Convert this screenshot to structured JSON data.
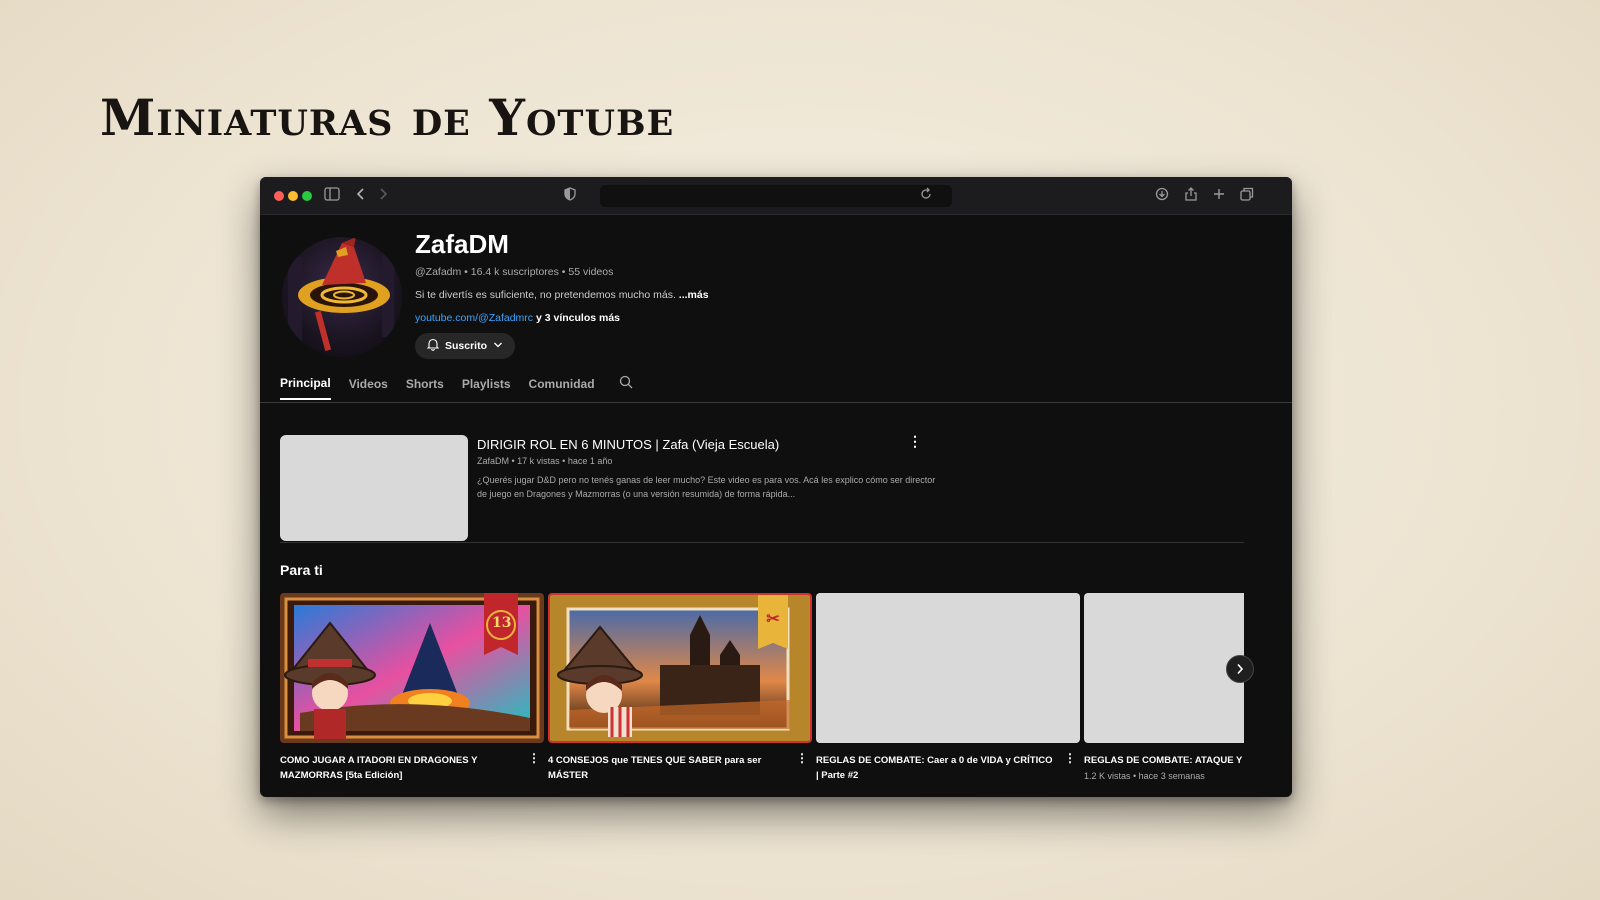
{
  "page_title": "Miniaturas de Yotube",
  "channel": {
    "name": "ZafaDM",
    "meta": "@Zafadm • 16.4 k suscriptores • 55 videos",
    "description": "Si te divertís es suficiente, no pretendemos mucho más.",
    "description_more": "...más",
    "link": "youtube.com/@Zafadmrc",
    "link_more": " y 3 vínculos más",
    "subscribe_label": "Suscrito"
  },
  "tabs": [
    "Principal",
    "Videos",
    "Shorts",
    "Playlists",
    "Comunidad"
  ],
  "featured": {
    "title": "DIRIGIR ROL EN 6 MINUTOS | Zafa (Vieja Escuela)",
    "meta": "ZafaDM • 17 k vistas • hace 1 año",
    "description": "¿Querés jugar D&D pero no tenés ganas de leer mucho? Este video es para vos. Acá les explico cómo ser director de juego en Dragones y Mazmorras (o una versión resumida) de forma rápida..."
  },
  "section_title": "Para ti",
  "cards": [
    {
      "title": "COMO JUGAR A ITADORI EN DRAGONES Y MAZMORRAS [5ta Edición]",
      "meta": "",
      "thumb": "book",
      "badge": "13"
    },
    {
      "title": "4 CONSEJOS que TENES QUE SABER para ser MÁSTER",
      "meta": "",
      "thumb": "city",
      "badge": "✂"
    },
    {
      "title": "REGLAS DE COMBATE: Caer a 0 de VIDA y CRÍTICO | Parte #2",
      "meta": "",
      "thumb": "blank"
    },
    {
      "title": "REGLAS DE COMBATE: ATAQUE Y",
      "meta": "1.2 K vistas • hace 3 semanas",
      "thumb": "blank"
    }
  ],
  "icons": [
    "sidebar-icon",
    "back-icon",
    "forward-icon",
    "shield-icon",
    "reload-icon",
    "download-icon",
    "share-icon",
    "new-tab-icon",
    "tabs-icon",
    "bell-icon",
    "chevron-down-icon",
    "search-icon",
    "more-icon",
    "next-icon"
  ],
  "colors": {
    "accent_link": "#3ea6ff",
    "badge_red": "#c0262c",
    "badge_gold": "#e8b43a"
  }
}
